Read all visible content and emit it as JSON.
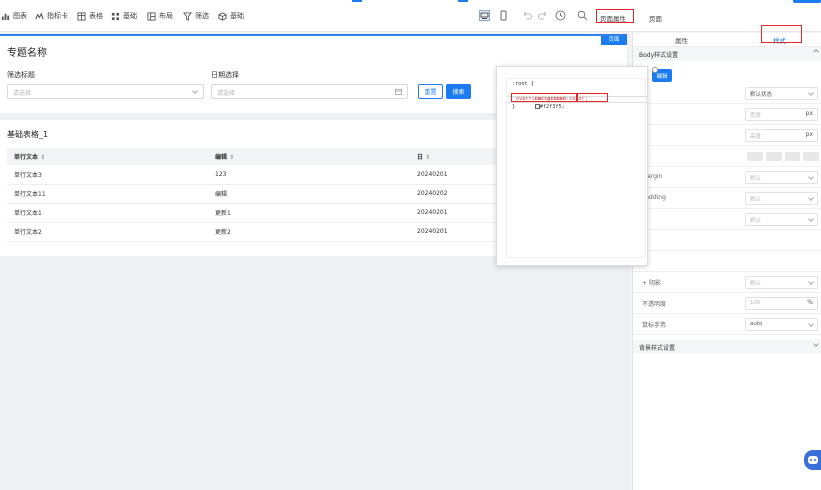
{
  "toolbar": {
    "items": [
      {
        "label": "图表",
        "icon": "chart-icon"
      },
      {
        "label": "指标卡",
        "icon": "metric-card-icon"
      },
      {
        "label": "表格",
        "icon": "table-icon"
      },
      {
        "label": "基础",
        "icon": "basic-icon"
      },
      {
        "label": "布局",
        "icon": "layout-icon"
      },
      {
        "label": "筛选",
        "icon": "filter-icon"
      },
      {
        "label": "基础",
        "icon": "cube-icon"
      }
    ],
    "page_props": "页面属性",
    "page_btn": "页面"
  },
  "canvas": {
    "page_badge": "页面",
    "title": "专题名称",
    "filter1_label": "筛选标题",
    "filter1_placeholder": "请选择",
    "filter2_label": "日期选择",
    "filter2_placeholder": "请选择",
    "reset": "重置",
    "search": "搜索",
    "table_title": "基础表格_1",
    "columns": [
      "单行文本",
      "编辑",
      "日"
    ],
    "rows": [
      [
        "单行文本3",
        "123",
        "20240201"
      ],
      [
        "单行文本11",
        "编辑",
        "20240202"
      ],
      [
        "单行文本1",
        "更新1",
        "20240201"
      ],
      [
        "单行文本2",
        "更新2",
        "20240201"
      ]
    ]
  },
  "popup": {
    "line1": ":root {",
    "line2_prop": "background-color:",
    "line2_val": "#f2f3f5;",
    "line3": "overflow: hidden",
    "line4": "}",
    "edit": "编辑"
  },
  "panel": {
    "tab_props": "属性",
    "tab_style": "样式",
    "body_section": "Body样式设置",
    "state_default": "默认状态",
    "width_ph": "宽度",
    "height_ph": "高度",
    "unit": "px",
    "margin_label": "Margin",
    "padding_label": "Padding",
    "default_ph": "默认",
    "shadow_label": "阴影",
    "opacity_label": "不透明度",
    "opacity_ph": "100",
    "opacity_unit": "%",
    "cursor_label": "鼠标手势",
    "cursor_val": "auto",
    "bg_section": "背景样式设置"
  },
  "colors": {
    "accent": "#1a7cf0",
    "highlight": "#e0282e",
    "code_prop": "#d03b3b",
    "code_fg": "#333333"
  }
}
